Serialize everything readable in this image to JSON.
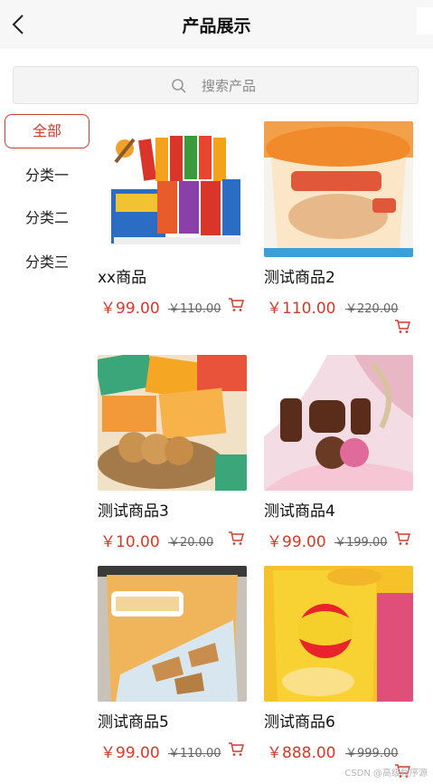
{
  "header": {
    "title": "产品展示",
    "back_icon": "chevron-left-icon"
  },
  "search": {
    "placeholder": "搜索产品",
    "icon": "search-icon"
  },
  "categories": [
    {
      "label": "全部",
      "active": true
    },
    {
      "label": "分类一",
      "active": false
    },
    {
      "label": "分类二",
      "active": false
    },
    {
      "label": "分类三",
      "active": false
    }
  ],
  "products": [
    {
      "name": "xx商品",
      "price": "￥99.00",
      "original_price": "￥110.00",
      "cart_icon": "cart-icon"
    },
    {
      "name": "测试商品2",
      "price": "￥110.00",
      "original_price": "￥220.00",
      "cart_icon": "cart-icon"
    },
    {
      "name": "测试商品3",
      "price": "￥10.00",
      "original_price": "￥20.00",
      "cart_icon": "cart-icon"
    },
    {
      "name": "测试商品4",
      "price": "￥99.00",
      "original_price": "￥199.00",
      "cart_icon": "cart-icon"
    },
    {
      "name": "测试商品5",
      "price": "￥99.00",
      "original_price": "￥110.00",
      "cart_icon": "cart-icon"
    },
    {
      "name": "测试商品6",
      "price": "￥888.00",
      "original_price": "￥999.00",
      "cart_icon": "cart-icon"
    }
  ],
  "colors": {
    "accent": "#d23a2a"
  },
  "watermark": "CSDN @高级程序源"
}
